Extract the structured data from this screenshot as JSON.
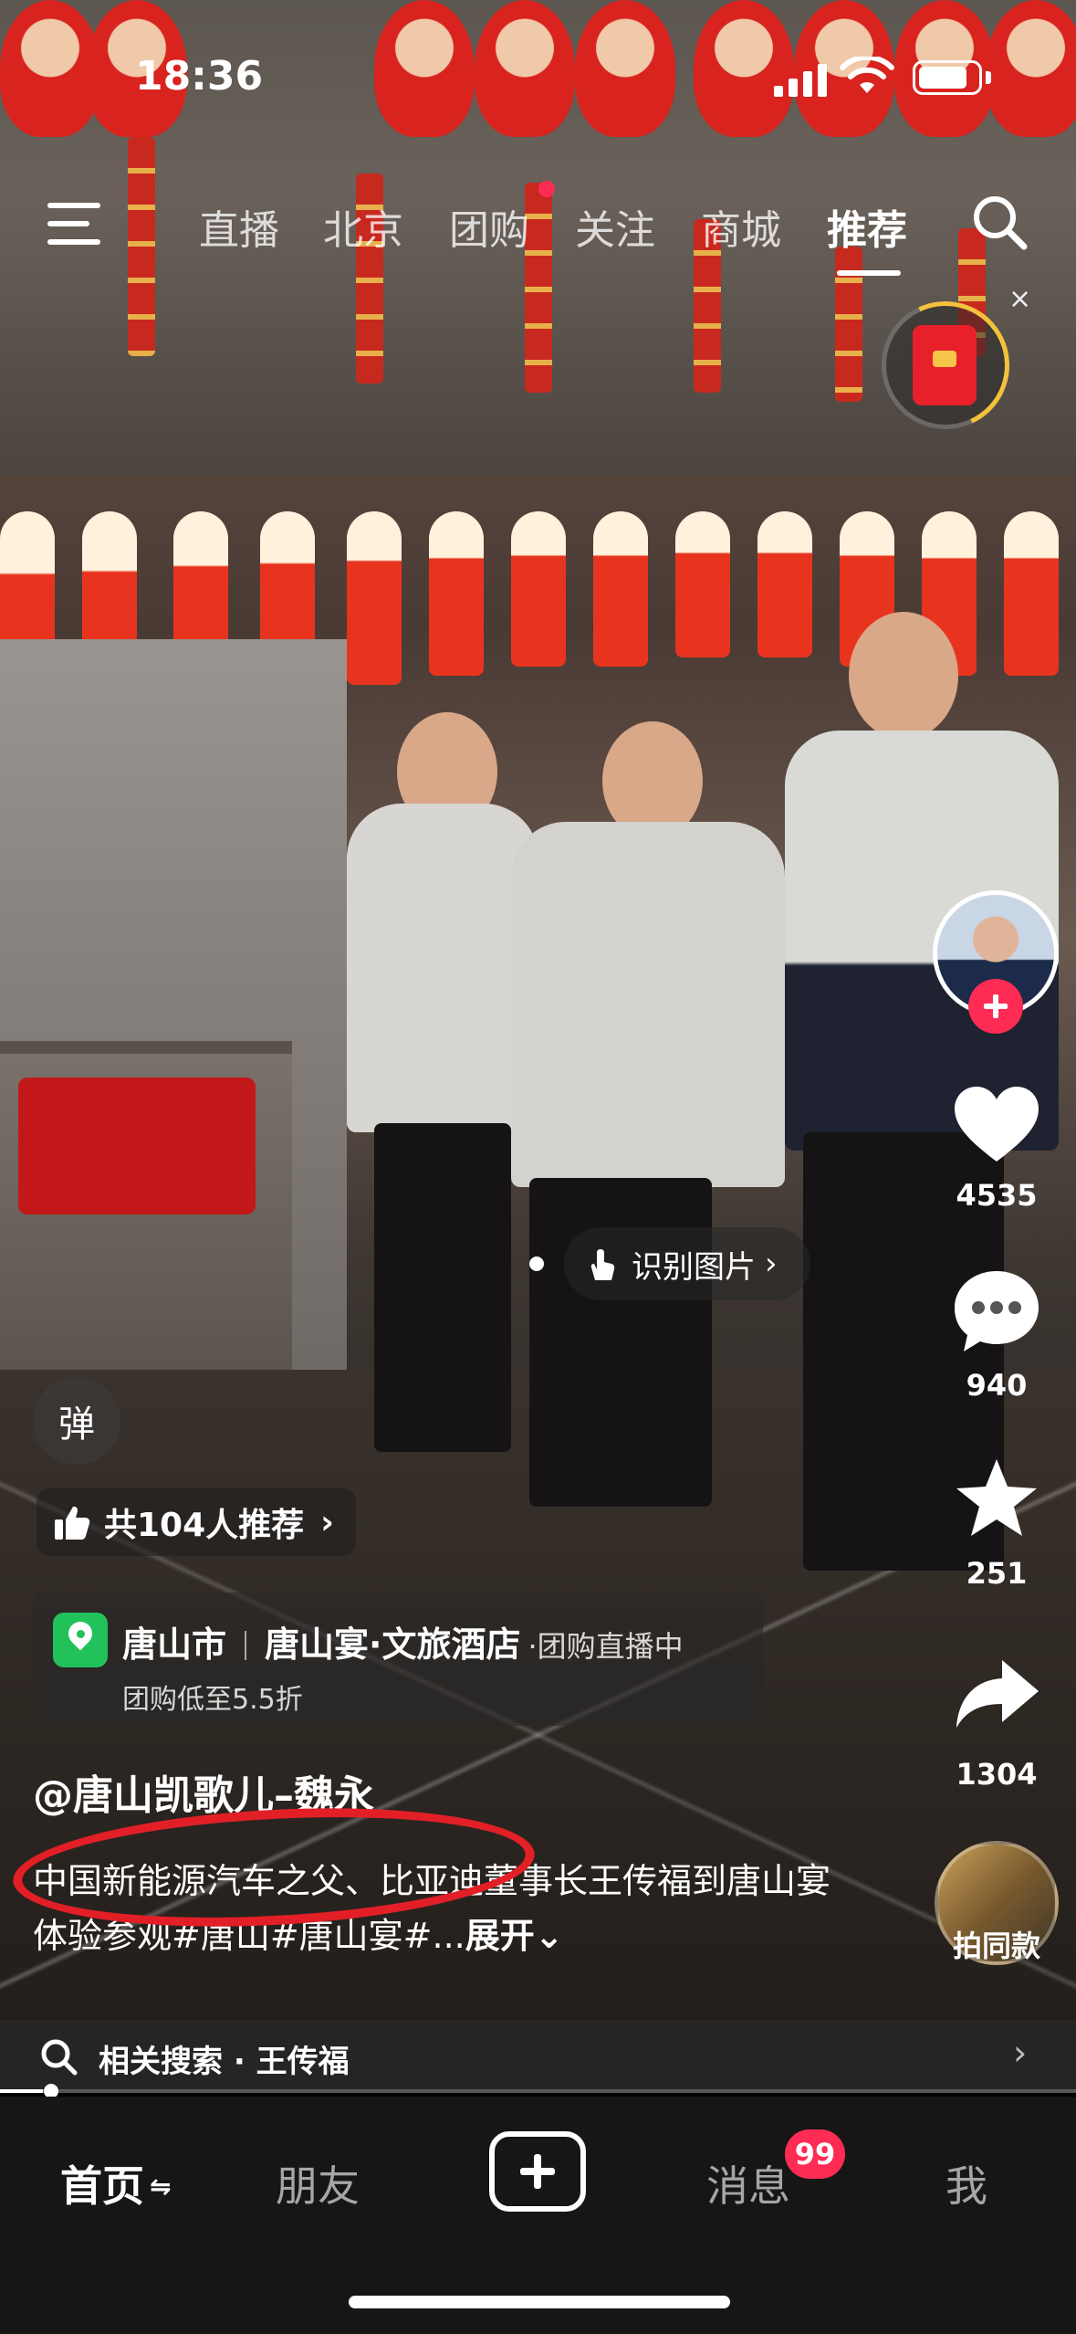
{
  "status_bar": {
    "time": "18:36"
  },
  "top_nav": {
    "tabs": [
      {
        "label": "直播",
        "active": false
      },
      {
        "label": "北京",
        "active": false
      },
      {
        "label": "团购",
        "active": false
      },
      {
        "label": "关注",
        "active": false
      },
      {
        "label": "商城",
        "active": false
      },
      {
        "label": "推荐",
        "active": true
      }
    ]
  },
  "red_packet": {
    "close": "×"
  },
  "center_pill": {
    "label": "识别图片",
    "chevron": "›"
  },
  "danmaku": {
    "label": "弹"
  },
  "actions": {
    "like_count": "4535",
    "comment_count": "940",
    "favorite_count": "251",
    "share_count": "1304",
    "same_style_label": "拍同款"
  },
  "recommend": {
    "label": "共104人推荐",
    "chevron": "›"
  },
  "poi": {
    "city": "唐山市",
    "venue": "唐山宴·文旅酒店",
    "live_status": "·团购直播中",
    "deal": "团购低至5.5折"
  },
  "post": {
    "author": "@唐山凯歌儿–魏永",
    "description": "中国新能源汽车之父、比亚迪董事长王传福到唐山宴体验参观#唐山#唐山宴#...",
    "more_label": "展开⌄"
  },
  "related_search": {
    "prefix": "相关搜索 · ",
    "query": "王传福",
    "chevron": "›"
  },
  "progress": {
    "fraction": 0.04
  },
  "tab_bar": {
    "home": "首页",
    "home_suffix": "⇋",
    "friends": "朋友",
    "messages": "消息",
    "messages_badge": "99",
    "me": "我"
  },
  "colors": {
    "accent": "#fe2c55",
    "annotation_circle": "#e21f27",
    "poi_green": "#22c25b"
  }
}
